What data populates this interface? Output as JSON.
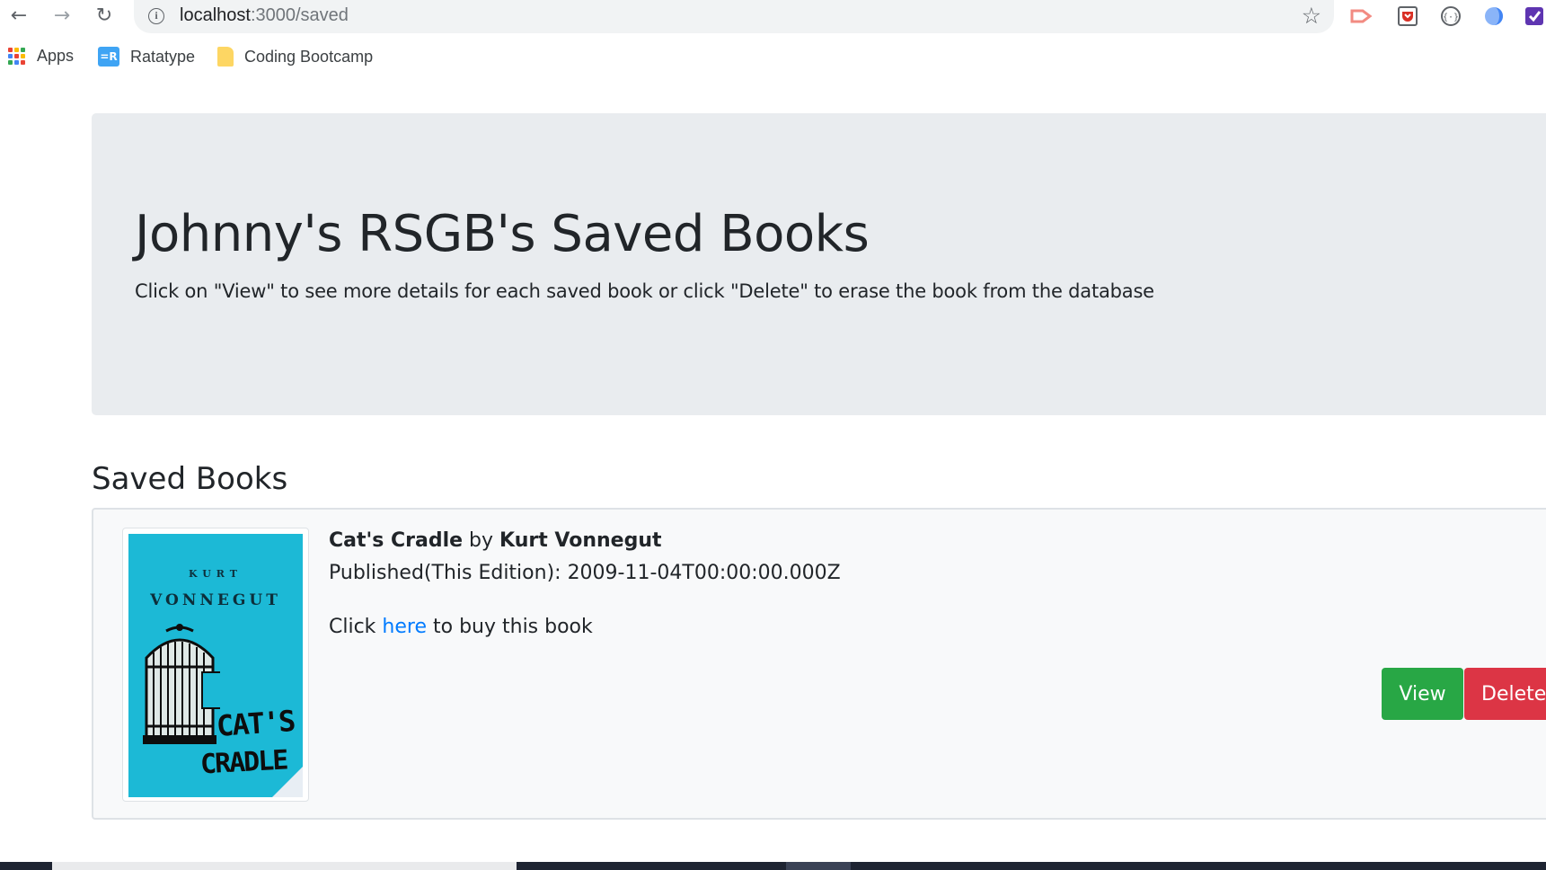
{
  "browser": {
    "url_host": "localhost",
    "url_path": ":3000/saved",
    "bookmarks": [
      {
        "label": "Apps",
        "icon": "apps-grid-icon"
      },
      {
        "label": "Ratatype",
        "icon": "ratatype-icon",
        "icon_text": "=R"
      },
      {
        "label": "Coding Bootcamp",
        "icon": "folder-icon"
      }
    ],
    "nav": {
      "back": "←",
      "forward": "→",
      "reload": "↻",
      "star": "☆"
    }
  },
  "jumbotron": {
    "title": "Johnny's RSGB's Saved Books",
    "lead": "Click on \"View\" to see more details for each saved book or click \"Delete\" to erase the book from the database"
  },
  "saved": {
    "heading": "Saved Books",
    "books": [
      {
        "title": "Cat's Cradle",
        "by": " by ",
        "author": "Kurt Vonnegut",
        "published_label": "Published(This Edition): ",
        "published": "2009-11-04T00:00:00.000Z",
        "buy_prefix": "Click ",
        "buy_link": "here",
        "buy_suffix": " to buy this book",
        "cover": {
          "author_small": "KURT",
          "author": "VONNEGUT",
          "title_1": "CAT'S",
          "title_2": "CRADLE",
          "bg_color": "#1cb9d6"
        },
        "view_label": "View",
        "delete_label": "Delete"
      }
    ]
  },
  "colors": {
    "view": "#28a745",
    "delete": "#dc3545",
    "link": "#007bff",
    "jumbotron": "#e9ecef"
  }
}
